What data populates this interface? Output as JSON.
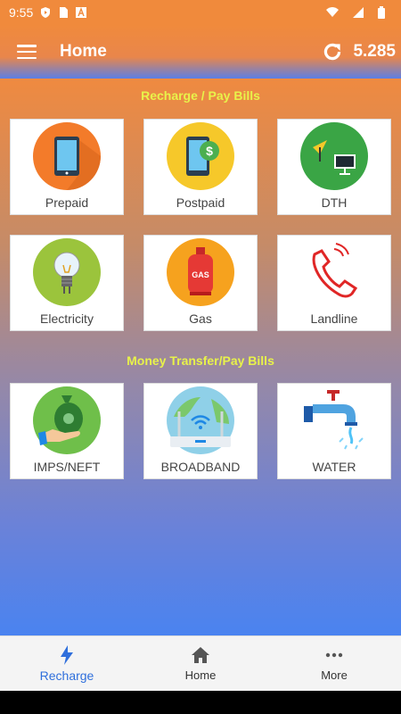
{
  "statusbar": {
    "time": "9:55"
  },
  "appbar": {
    "title": "Home",
    "balance": "5.285"
  },
  "sections": [
    {
      "title": "Recharge / Pay Bills",
      "tiles": [
        {
          "label": "Prepaid",
          "icon": "prepaid-phone-icon"
        },
        {
          "label": "Postpaid",
          "icon": "postpaid-phone-dollar-icon"
        },
        {
          "label": "DTH",
          "icon": "dth-satellite-tv-icon"
        },
        {
          "label": "Electricity",
          "icon": "lightbulb-icon"
        },
        {
          "label": "Gas",
          "icon": "gas-cylinder-icon"
        },
        {
          "label": "Landline",
          "icon": "landline-phone-icon"
        }
      ]
    },
    {
      "title": "Money Transfer/Pay Bills",
      "tiles": [
        {
          "label": "IMPS/NEFT",
          "icon": "money-bag-hand-icon"
        },
        {
          "label": "BROADBAND",
          "icon": "wifi-router-icon"
        },
        {
          "label": "WATER",
          "icon": "water-tap-icon"
        }
      ]
    }
  ],
  "bottom_nav": [
    {
      "label": "Recharge",
      "icon": "lightning-icon",
      "active": true
    },
    {
      "label": "Home",
      "icon": "home-icon",
      "active": false
    },
    {
      "label": "More",
      "icon": "more-dots-icon",
      "active": false
    }
  ],
  "colors": {
    "section_title": "#e8f24a",
    "active_nav": "#2f6fdc",
    "orange_top": "#f08a3c",
    "blue_bottom": "#4a83f0"
  }
}
